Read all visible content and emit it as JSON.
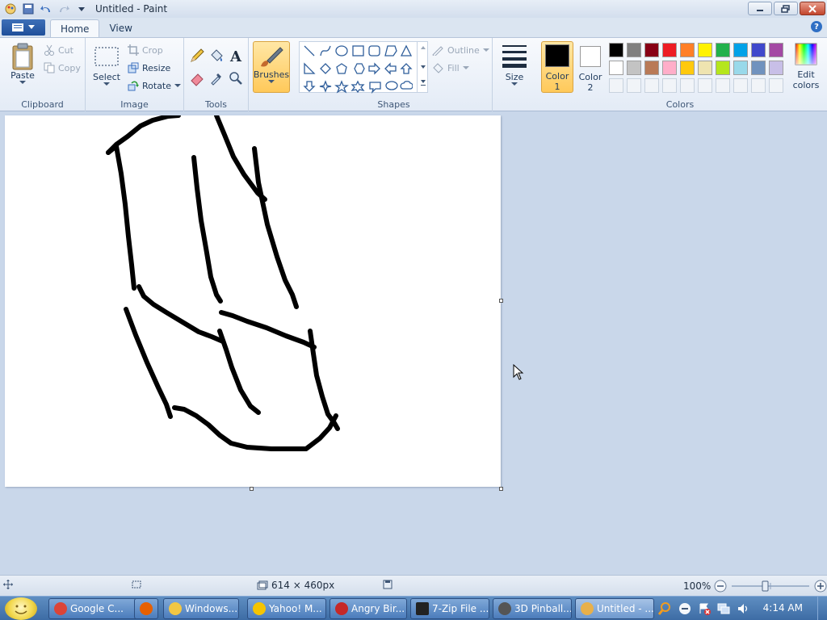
{
  "window": {
    "title": "Untitled - Paint"
  },
  "tabs": [
    {
      "label": "Home"
    },
    {
      "label": "View"
    }
  ],
  "help_label": "?",
  "ribbon": {
    "clipboard": {
      "label": "Clipboard",
      "paste": "Paste",
      "cut": "Cut",
      "copy": "Copy"
    },
    "image": {
      "label": "Image",
      "select": "Select",
      "crop": "Crop",
      "resize": "Resize",
      "rotate": "Rotate"
    },
    "tools": {
      "label": "Tools"
    },
    "brushes": {
      "label": "Brushes"
    },
    "shapes": {
      "label": "Shapes",
      "outline": "Outline",
      "fill": "Fill"
    },
    "size": {
      "label": "Size"
    },
    "color1": {
      "line1": "Color",
      "line2": "1",
      "value": "#000000"
    },
    "color2": {
      "line1": "Color",
      "line2": "2",
      "value": "#ffffff"
    },
    "colors": {
      "label": "Colors",
      "edit_line1": "Edit",
      "edit_line2": "colors",
      "row1": [
        "#000000",
        "#7f7f7f",
        "#880015",
        "#ed1c24",
        "#ff7f27",
        "#fff200",
        "#22b14c",
        "#00a2e8",
        "#3f48cc",
        "#a349a4"
      ],
      "row2": [
        "#ffffff",
        "#c3c3c3",
        "#b97a57",
        "#ffaec9",
        "#ffc90e",
        "#efe4b0",
        "#b5e61d",
        "#99d9ea",
        "#7092be",
        "#c8bfe7"
      ]
    }
  },
  "status": {
    "canvas_size": "614 × 460px",
    "zoom": "100%"
  },
  "taskbar": {
    "items": [
      {
        "label": "Google C...",
        "color": "#db4437"
      },
      {
        "label": "",
        "color": "#e66000"
      },
      {
        "label": "Windows...",
        "color": "#f2c744"
      },
      {
        "label": "Yahoo! M...",
        "color": "#f5c400"
      },
      {
        "label": "Angry Bir...",
        "color": "#c62828"
      },
      {
        "label": "7-Zip File ...",
        "color": "#222222"
      },
      {
        "label": "3D Pinball...",
        "color": "#555555"
      },
      {
        "label": "Untitled - ...",
        "color": "#e8b04a"
      }
    ],
    "clock": "4:14 AM"
  }
}
